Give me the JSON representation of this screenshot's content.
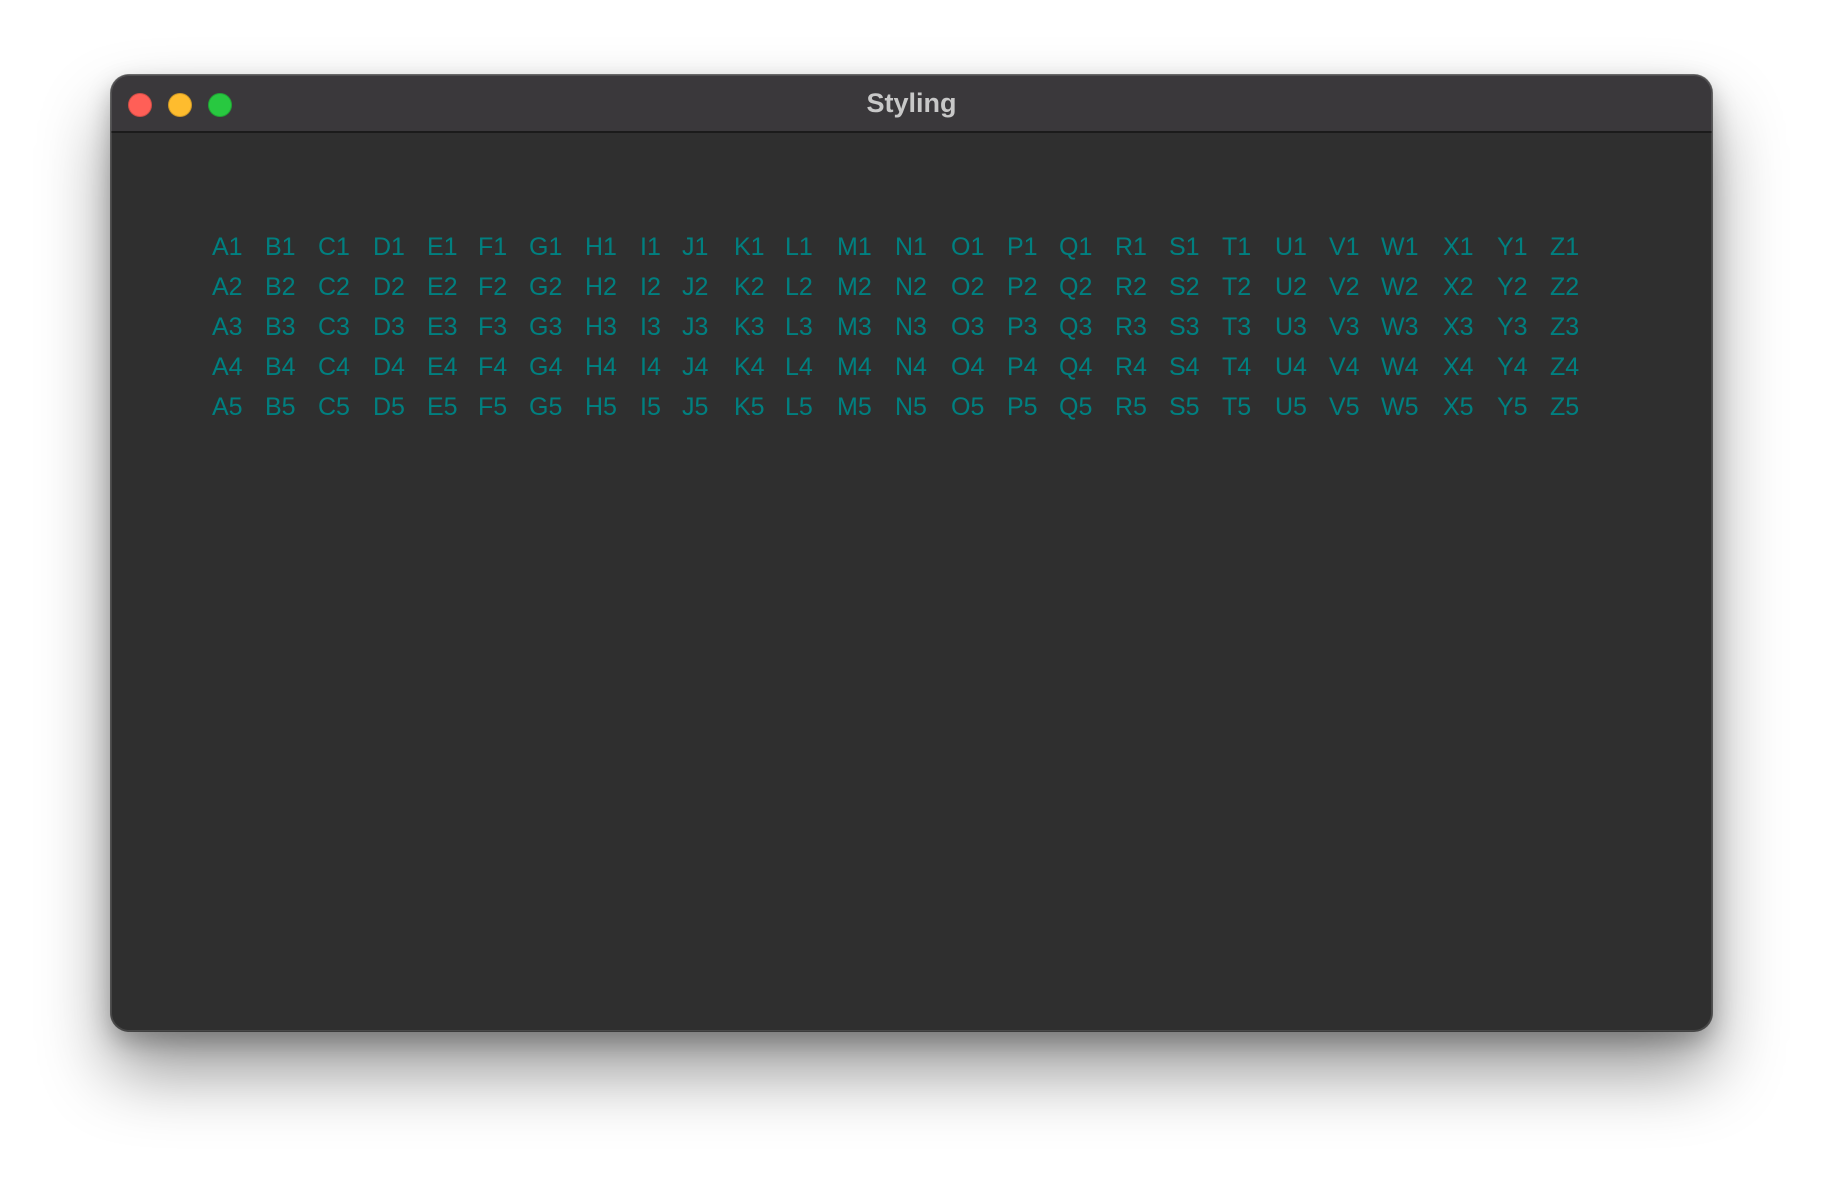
{
  "window": {
    "title": "Styling"
  },
  "traffic_lights": {
    "close_color": "#ff5f57",
    "minimize_color": "#febc2e",
    "zoom_color": "#28c840"
  },
  "grid": {
    "text_color": "#008080",
    "letters": [
      "A",
      "B",
      "C",
      "D",
      "E",
      "F",
      "G",
      "H",
      "I",
      "J",
      "K",
      "L",
      "M",
      "N",
      "O",
      "P",
      "Q",
      "R",
      "S",
      "T",
      "U",
      "V",
      "W",
      "X",
      "Y",
      "Z"
    ],
    "rows": [
      1,
      2,
      3,
      4,
      5
    ]
  }
}
